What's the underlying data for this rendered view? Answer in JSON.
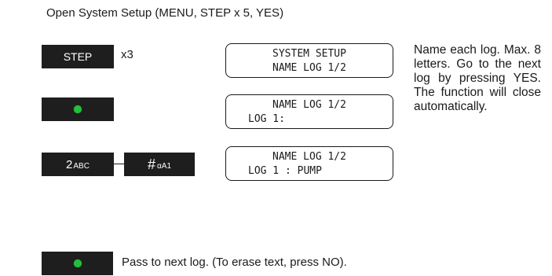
{
  "heading": "Open System Setup (MENU, STEP x 5, YES)",
  "keys": {
    "step_label": "STEP",
    "step_multiplier": "x3",
    "key2_main": "2",
    "key2_sub": "ABC",
    "hash_main": "#",
    "hash_sub": "αA1",
    "yes_indicator_color": "#22c03b"
  },
  "displays": [
    {
      "line1": "SYSTEM SETUP",
      "line2": "NAME LOG 1/2"
    },
    {
      "line1": "NAME LOG 1/2",
      "line2": "LOG 1:"
    },
    {
      "line1": "NAME LOG 1/2",
      "line2": "LOG 1 : PUMP"
    }
  ],
  "description": "Name each log. Max. 8 letters. Go to the next log by pressing YES. The function will close automatically.",
  "footer": "Pass to next log. (To erase text, press NO)."
}
